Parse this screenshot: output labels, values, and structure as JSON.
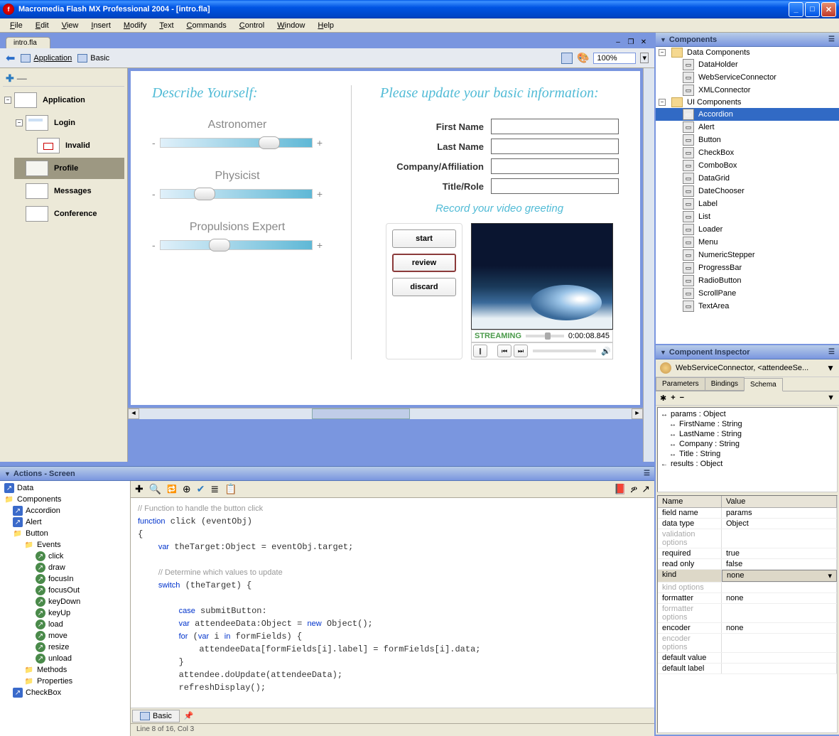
{
  "title": "Macromedia Flash MX Professional 2004  -  [intro.fla]",
  "menus": [
    "File",
    "Edit",
    "View",
    "Insert",
    "Modify",
    "Text",
    "Commands",
    "Control",
    "Window",
    "Help"
  ],
  "doc": {
    "tab": "intro.fla",
    "breadcrumb": [
      "Application",
      "Basic"
    ],
    "zoom": "100%"
  },
  "screenTree": [
    {
      "label": "Application",
      "level": 0,
      "selected": false,
      "exp": "-"
    },
    {
      "label": "Login",
      "level": 1,
      "selected": false,
      "exp": "-",
      "thumb": "login"
    },
    {
      "label": "Invalid",
      "level": 2,
      "selected": false,
      "thumb": "invalid"
    },
    {
      "label": "Profile",
      "level": 1,
      "selected": true,
      "thumb": "profile"
    },
    {
      "label": "Messages",
      "level": 1,
      "selected": false
    },
    {
      "label": "Conference",
      "level": 1,
      "selected": false
    }
  ],
  "stage": {
    "describeHeading": "Describe Yourself:",
    "updateHeading": "Please update your basic information:",
    "sliders": [
      {
        "label": "Astronomer",
        "pos": 65
      },
      {
        "label": "Physicist",
        "pos": 22
      },
      {
        "label": "Propulsions Expert",
        "pos": 32
      }
    ],
    "fields": [
      "First Name",
      "Last Name",
      "Company/Affiliation",
      "Title/Role"
    ],
    "videoHeading": "Record your video greeting",
    "videoButtons": [
      "start",
      "review",
      "discard"
    ],
    "streaming": "STREAMING",
    "time": "0:00:08.845"
  },
  "actions": {
    "title": "Actions - Screen",
    "tree": [
      {
        "label": "Data",
        "icon": "book",
        "level": 0
      },
      {
        "label": "Components",
        "icon": "folder",
        "level": 0
      },
      {
        "label": "Accordion",
        "icon": "book",
        "level": 1
      },
      {
        "label": "Alert",
        "icon": "book",
        "level": 1
      },
      {
        "label": "Button",
        "icon": "folder",
        "level": 1
      },
      {
        "label": "Events",
        "icon": "folder",
        "level": 2
      },
      {
        "label": "click",
        "icon": "arrow",
        "level": 3
      },
      {
        "label": "draw",
        "icon": "arrow",
        "level": 3
      },
      {
        "label": "focusIn",
        "icon": "arrow",
        "level": 3
      },
      {
        "label": "focusOut",
        "icon": "arrow",
        "level": 3
      },
      {
        "label": "keyDown",
        "icon": "arrow",
        "level": 3
      },
      {
        "label": "keyUp",
        "icon": "arrow",
        "level": 3
      },
      {
        "label": "load",
        "icon": "arrow",
        "level": 3
      },
      {
        "label": "move",
        "icon": "arrow",
        "level": 3
      },
      {
        "label": "resize",
        "icon": "arrow",
        "level": 3
      },
      {
        "label": "unload",
        "icon": "arrow",
        "level": 3
      },
      {
        "label": "Methods",
        "icon": "folder",
        "level": 2
      },
      {
        "label": "Properties",
        "icon": "folder",
        "level": 2
      },
      {
        "label": "CheckBox",
        "icon": "book",
        "level": 1
      }
    ],
    "codeTab": "Basic",
    "status": "Line 8 of 16, Col 3"
  },
  "components": {
    "title": "Components",
    "groups": [
      {
        "label": "Data Components",
        "items": [
          {
            "label": "DataHolder"
          },
          {
            "label": "WebServiceConnector"
          },
          {
            "label": "XMLConnector"
          }
        ]
      },
      {
        "label": "UI Components",
        "items": [
          {
            "label": "Accordion",
            "selected": true
          },
          {
            "label": "Alert"
          },
          {
            "label": "Button"
          },
          {
            "label": "CheckBox"
          },
          {
            "label": "ComboBox"
          },
          {
            "label": "DataGrid"
          },
          {
            "label": "DateChooser"
          },
          {
            "label": "Label"
          },
          {
            "label": "List"
          },
          {
            "label": "Loader"
          },
          {
            "label": "Menu"
          },
          {
            "label": "NumericStepper"
          },
          {
            "label": "ProgressBar"
          },
          {
            "label": "RadioButton"
          },
          {
            "label": "ScrollPane"
          },
          {
            "label": "TextArea"
          }
        ]
      }
    ]
  },
  "inspector": {
    "title": "Component Inspector",
    "selection": "WebServiceConnector, <attendeeSe...",
    "tabs": [
      "Parameters",
      "Bindings",
      "Schema"
    ],
    "activeTab": 2,
    "schema": [
      {
        "label": "params : Object",
        "level": 0,
        "icon": "↔"
      },
      {
        "label": "FirstName : String",
        "level": 1,
        "icon": "↔"
      },
      {
        "label": "LastName : String",
        "level": 1,
        "icon": "↔"
      },
      {
        "label": "Company : String",
        "level": 1,
        "icon": "↔"
      },
      {
        "label": "Title : String",
        "level": 1,
        "icon": "↔"
      },
      {
        "label": "results : Object",
        "level": 0,
        "icon": "←"
      }
    ],
    "propsHeader": [
      "Name",
      "Value"
    ],
    "props": [
      {
        "name": "field name",
        "value": "params",
        "disabled": false
      },
      {
        "name": "data type",
        "value": "Object",
        "disabled": false
      },
      {
        "name": "validation options",
        "value": "",
        "disabled": true
      },
      {
        "name": "required",
        "value": "true",
        "disabled": false
      },
      {
        "name": "read only",
        "value": "false",
        "disabled": false
      },
      {
        "name": "kind",
        "value": "none",
        "disabled": false,
        "selected": true
      },
      {
        "name": "kind options",
        "value": "",
        "disabled": true
      },
      {
        "name": "formatter",
        "value": "none",
        "disabled": false
      },
      {
        "name": "formatter options",
        "value": "",
        "disabled": true
      },
      {
        "name": "encoder",
        "value": "none",
        "disabled": false
      },
      {
        "name": "encoder options",
        "value": "",
        "disabled": true
      },
      {
        "name": "default value",
        "value": "",
        "disabled": false
      },
      {
        "name": "default label",
        "value": "",
        "disabled": false
      }
    ]
  }
}
